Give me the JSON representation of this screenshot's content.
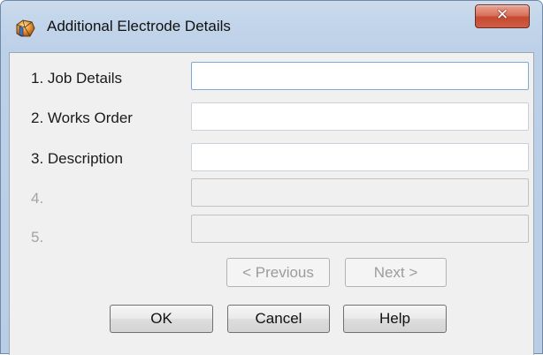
{
  "window": {
    "title": "Additional Electrode Details",
    "close_glyph": "✕"
  },
  "icons": {
    "app_icon": "electrode-app-icon",
    "close": "close-icon"
  },
  "form": {
    "fields": [
      {
        "label": "1. Job Details",
        "value": "",
        "enabled": true,
        "focused": true
      },
      {
        "label": "2. Works Order",
        "value": "",
        "enabled": true,
        "focused": false
      },
      {
        "label": "3. Description",
        "value": "",
        "enabled": true,
        "focused": false
      },
      {
        "label": "4.",
        "value": "",
        "enabled": false,
        "focused": false
      },
      {
        "label": "5.",
        "value": "",
        "enabled": false,
        "focused": false
      }
    ]
  },
  "navigation": {
    "previous_label": "< Previous",
    "next_label": "Next >",
    "previous_enabled": false,
    "next_enabled": false
  },
  "buttons": {
    "ok_label": "OK",
    "cancel_label": "Cancel",
    "help_label": "Help"
  },
  "colors": {
    "title_bar": "#c4d6ea",
    "close_button": "#c54a31",
    "client_background": "#f0f0f0",
    "disabled_text": "#a3a3a3"
  }
}
